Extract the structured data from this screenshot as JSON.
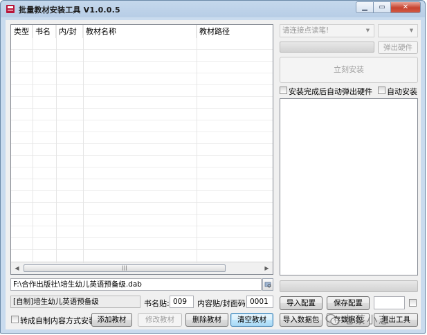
{
  "window": {
    "title": "批量教材安装工具 V1.0.0.5"
  },
  "list": {
    "columns": [
      "类型",
      "书名",
      "内/封",
      "教材名称",
      "教材路径"
    ]
  },
  "path": {
    "value": "F:\\合作出版社\\培生幼儿英语预备级.dab"
  },
  "book": {
    "name_value": "[自制]培生幼儿英语预备级",
    "sticker_label": "书名贴:",
    "sticker_value": "009",
    "code_label": "内容贴/封面码:",
    "code_value": "0001"
  },
  "left_actions": {
    "convert_label": "转成自制内容方式安装",
    "add": "添加教材",
    "edit": "修改教材",
    "delete": "删除教材",
    "clear": "清空教材"
  },
  "right": {
    "pen_combo": "请连接点读笔!",
    "eject_button": "弹出硬件",
    "install_button": "立刻安装",
    "auto_eject_label": "安装完成后自动弹出硬件",
    "auto_install_label": "自动安装",
    "import_config": "导入配置",
    "save_config": "保存配置",
    "import_package": "导入数据包",
    "save_package": "存数据包",
    "exit": "退出工具"
  },
  "scroll": {
    "thumb_grip": "|||"
  },
  "watermark": {
    "text": "老蔡小志"
  },
  "colors": {
    "titlebar": "#b7cde6",
    "default_button": "#bee6fd",
    "close_button": "#c7432f"
  }
}
